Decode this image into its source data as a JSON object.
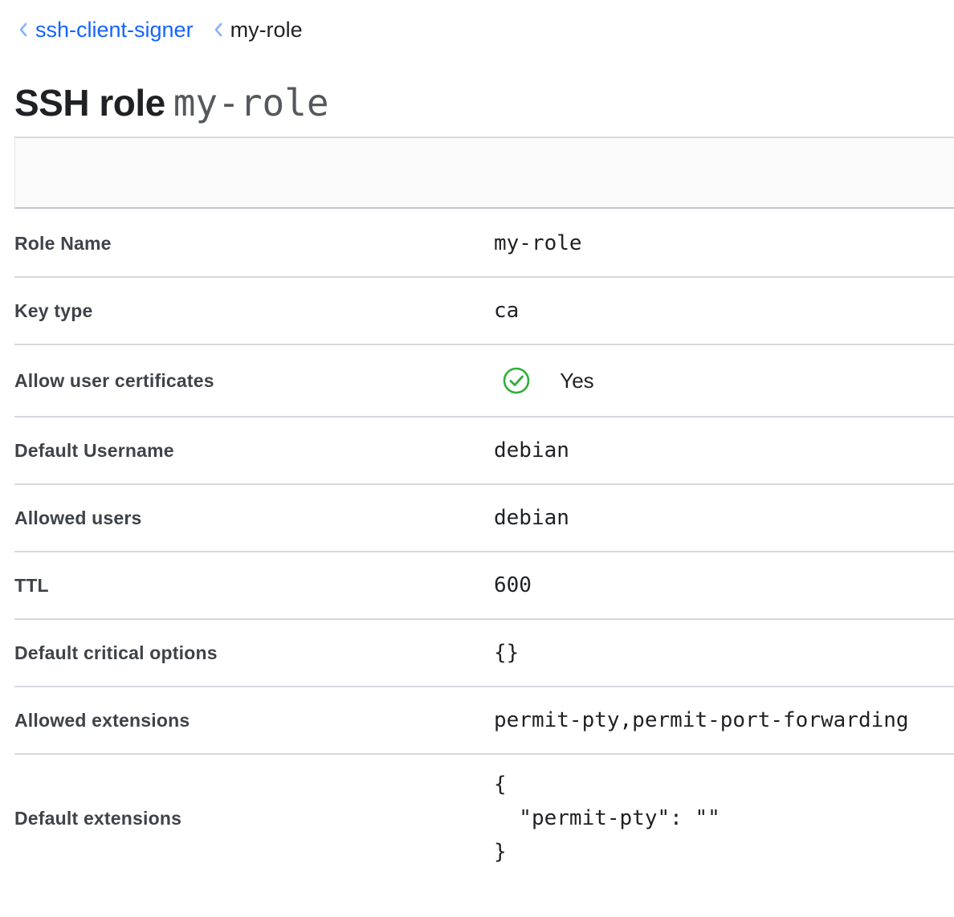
{
  "breadcrumb": {
    "items": [
      {
        "label": "ssh-client-signer"
      },
      {
        "label": "my-role"
      }
    ]
  },
  "header": {
    "title_prefix": "SSH role",
    "title_role": "my-role"
  },
  "details": {
    "role_name": {
      "label": "Role Name",
      "value": "my-role"
    },
    "key_type": {
      "label": "Key type",
      "value": "ca"
    },
    "allow_user_certificates": {
      "label": "Allow user certificates",
      "value": "Yes"
    },
    "default_username": {
      "label": "Default Username",
      "value": "debian"
    },
    "allowed_users": {
      "label": "Allowed users",
      "value": "debian"
    },
    "ttl": {
      "label": "TTL",
      "value": "600"
    },
    "default_critical_options": {
      "label": "Default critical options",
      "value": "{}"
    },
    "allowed_extensions": {
      "label": "Allowed extensions",
      "value": "permit-pty,permit-port-forwarding"
    },
    "default_extensions": {
      "label": "Default extensions",
      "value": "{\n  \"permit-pty\": \"\"\n}"
    }
  },
  "icons": {
    "breadcrumb_separator": "chevron-left-icon",
    "yes_status": "check-circle-icon"
  },
  "colors": {
    "link": "#1563ff",
    "success": "#2eb039",
    "chevron": "#8ab1ff"
  }
}
